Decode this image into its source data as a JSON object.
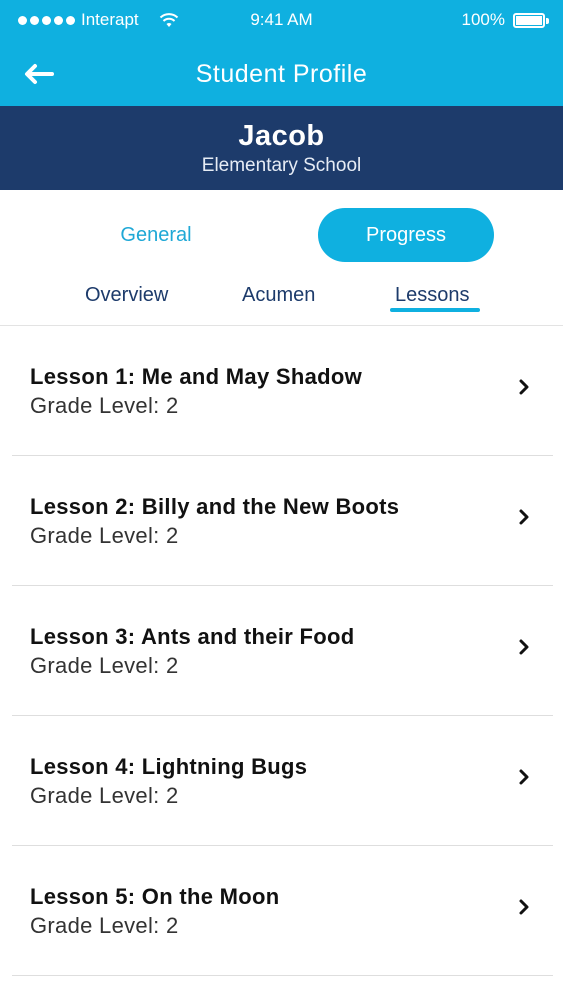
{
  "status_bar": {
    "carrier": "Interapt",
    "time": "9:41 AM",
    "battery": "100%"
  },
  "nav": {
    "title": "Student Profile",
    "back_icon": "back-arrow-icon"
  },
  "student": {
    "name": "Jacob",
    "school": "Elementary School"
  },
  "segments": [
    {
      "label": "General",
      "selected": false
    },
    {
      "label": "Progress",
      "selected": true
    }
  ],
  "subtabs": [
    {
      "label": "Overview",
      "selected": false
    },
    {
      "label": "Acumen",
      "selected": false
    },
    {
      "label": "Lessons",
      "selected": true
    }
  ],
  "lessons": [
    {
      "title": "Lesson 1: Me and May Shadow",
      "grade": "Grade Level: 2"
    },
    {
      "title": "Lesson 2: Billy and the New Boots",
      "grade": "Grade Level: 2"
    },
    {
      "title": "Lesson 3: Ants and their Food",
      "grade": "Grade Level: 2"
    },
    {
      "title": "Lesson 4: Lightning Bugs",
      "grade": "Grade Level: 2"
    },
    {
      "title": "Lesson 5: On the Moon",
      "grade": "Grade Level: 2"
    }
  ],
  "colors": {
    "accent": "#0fb0e0",
    "header_dark": "#1d3b6b"
  }
}
